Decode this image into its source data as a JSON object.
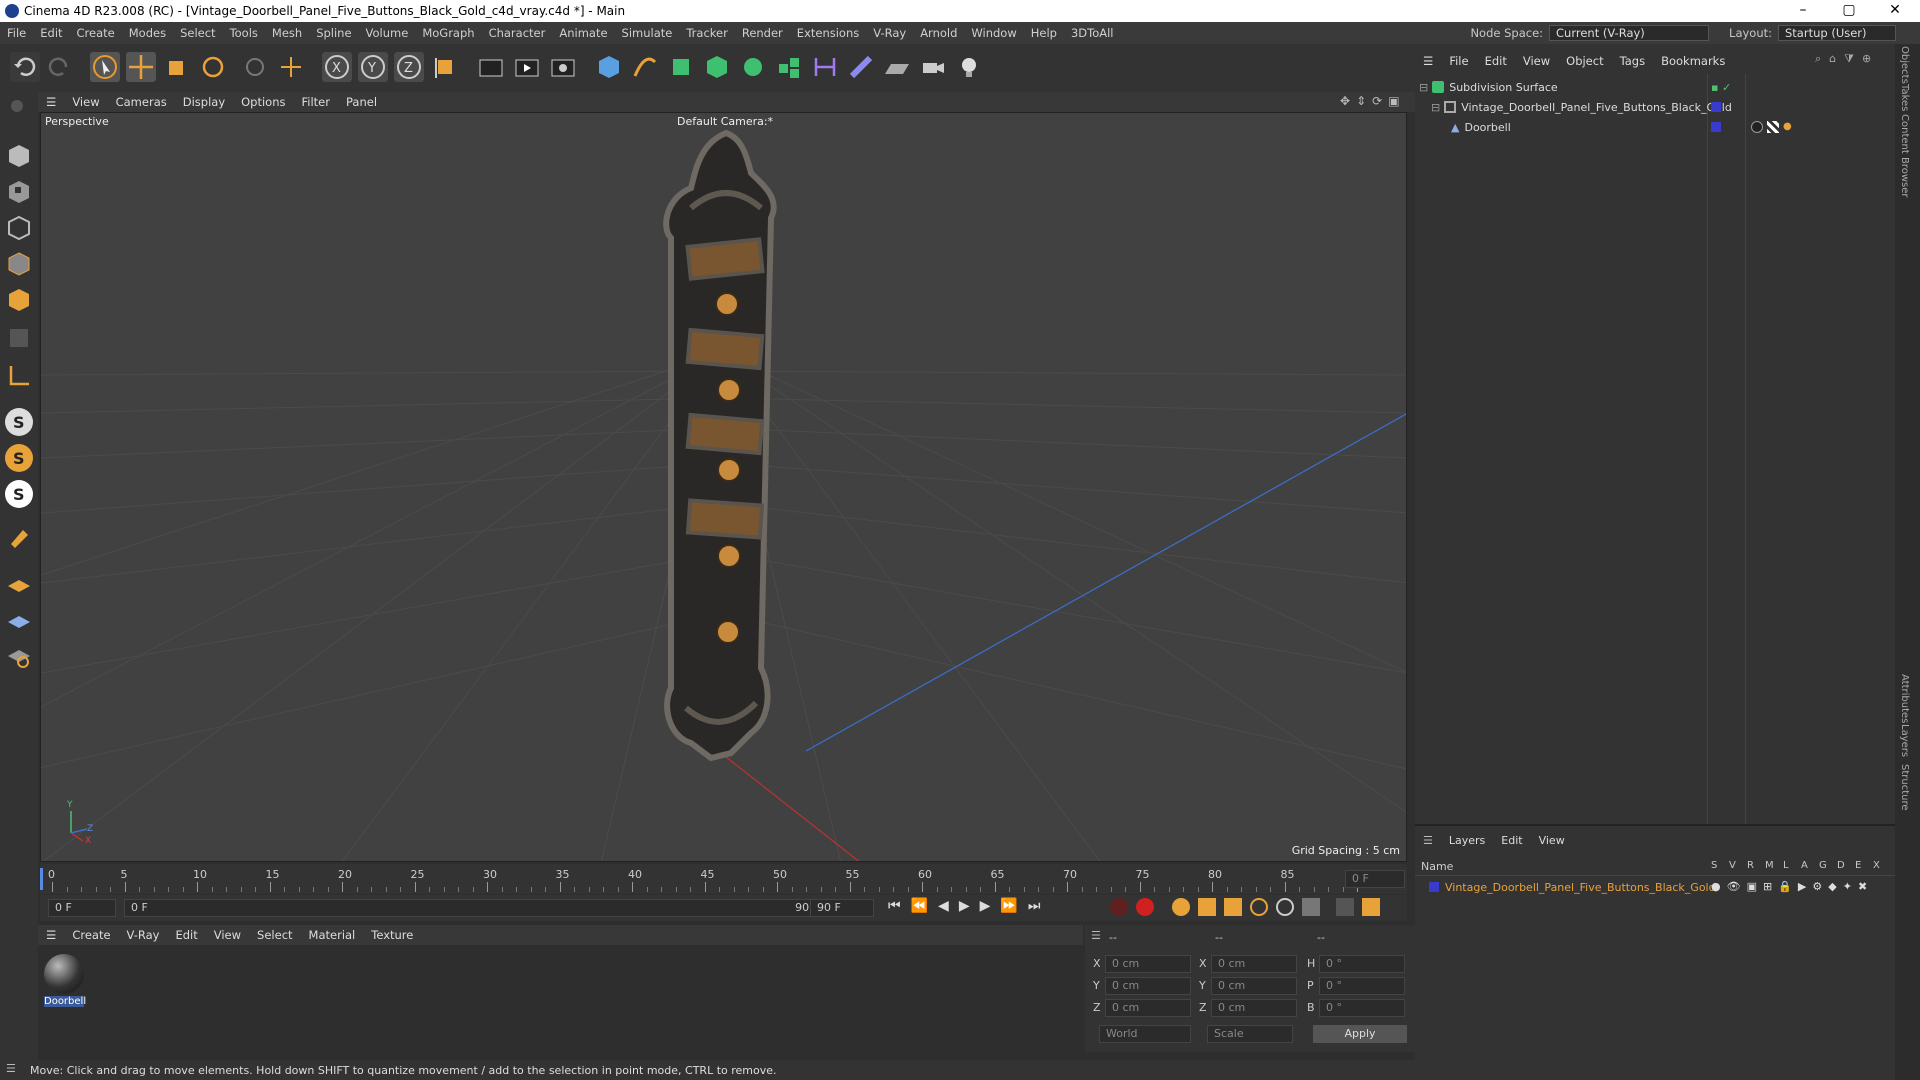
{
  "window": {
    "title": "Cinema 4D R23.008 (RC) - [Vintage_Doorbell_Panel_Five_Buttons_Black_Gold_c4d_vray.c4d *] - Main"
  },
  "menus": [
    "File",
    "Edit",
    "Create",
    "Modes",
    "Select",
    "Tools",
    "Mesh",
    "Spline",
    "Volume",
    "MoGraph",
    "Character",
    "Animate",
    "Simulate",
    "Tracker",
    "Render",
    "Extensions",
    "V-Ray",
    "Arnold",
    "Window",
    "Help",
    "3DToAll"
  ],
  "nodespace": {
    "label": "Node Space:",
    "value": "Current (V-Ray)",
    "layout_label": "Layout:",
    "layout_value": "Startup (User)"
  },
  "viewport": {
    "menu": [
      "View",
      "Cameras",
      "Display",
      "Options",
      "Filter",
      "Panel"
    ],
    "name": "Perspective",
    "camera": "Default Camera:*",
    "grid_spacing": "Grid Spacing : 5 cm"
  },
  "timeline": {
    "ticks": [
      "0",
      "5",
      "10",
      "15",
      "20",
      "25",
      "30",
      "35",
      "40",
      "45",
      "50",
      "55",
      "60",
      "65",
      "70",
      "75",
      "80",
      "85",
      "90"
    ],
    "end_field": "0 F",
    "start": "0 F",
    "current": "0 F",
    "range_end": "90 F",
    "max": "90 F"
  },
  "materials": {
    "menu": [
      "Create",
      "V-Ray",
      "Edit",
      "View",
      "Select",
      "Material",
      "Texture"
    ],
    "items": [
      {
        "name": "Doorbell"
      }
    ]
  },
  "coords": {
    "headers": [
      "--",
      "--",
      "--"
    ],
    "rows": [
      {
        "a": "X",
        "av": "0 cm",
        "b": "X",
        "bv": "0 cm",
        "c": "H",
        "cv": "0 °"
      },
      {
        "a": "Y",
        "av": "0 cm",
        "b": "Y",
        "bv": "0 cm",
        "c": "P",
        "cv": "0 °"
      },
      {
        "a": "Z",
        "av": "0 cm",
        "b": "Z",
        "bv": "0 cm",
        "c": "B",
        "cv": "0 °"
      }
    ],
    "mode": "World",
    "scale": "Scale",
    "apply": "Apply"
  },
  "objects": {
    "menu": [
      "File",
      "Edit",
      "View",
      "Object",
      "Tags",
      "Bookmarks"
    ],
    "items": [
      {
        "name": "Subdivision Surface"
      },
      {
        "name": "Vintage_Doorbell_Panel_Five_Buttons_Black_Gold"
      },
      {
        "name": "Doorbell"
      }
    ]
  },
  "layers": {
    "menu": [
      "Layers",
      "Edit",
      "View"
    ],
    "header_name": "Name",
    "columns": [
      "S",
      "V",
      "R",
      "M",
      "L",
      "A",
      "G",
      "D",
      "E",
      "X"
    ],
    "items": [
      {
        "name": "Vintage_Doorbell_Panel_Five_Buttons_Black_Gold",
        "color": "#3a3ad0"
      }
    ]
  },
  "side_tabs": [
    "Objects",
    "Takes",
    "Content Browser",
    "Attributes",
    "Layers",
    "Structure"
  ],
  "status": "Move: Click and drag to move elements. Hold down SHIFT to quantize movement / add to the selection in point mode, CTRL to remove.",
  "colors": {
    "accent": "#e87d1e",
    "blue": "#3a70d0",
    "layer_orange": "#e8a23a"
  }
}
